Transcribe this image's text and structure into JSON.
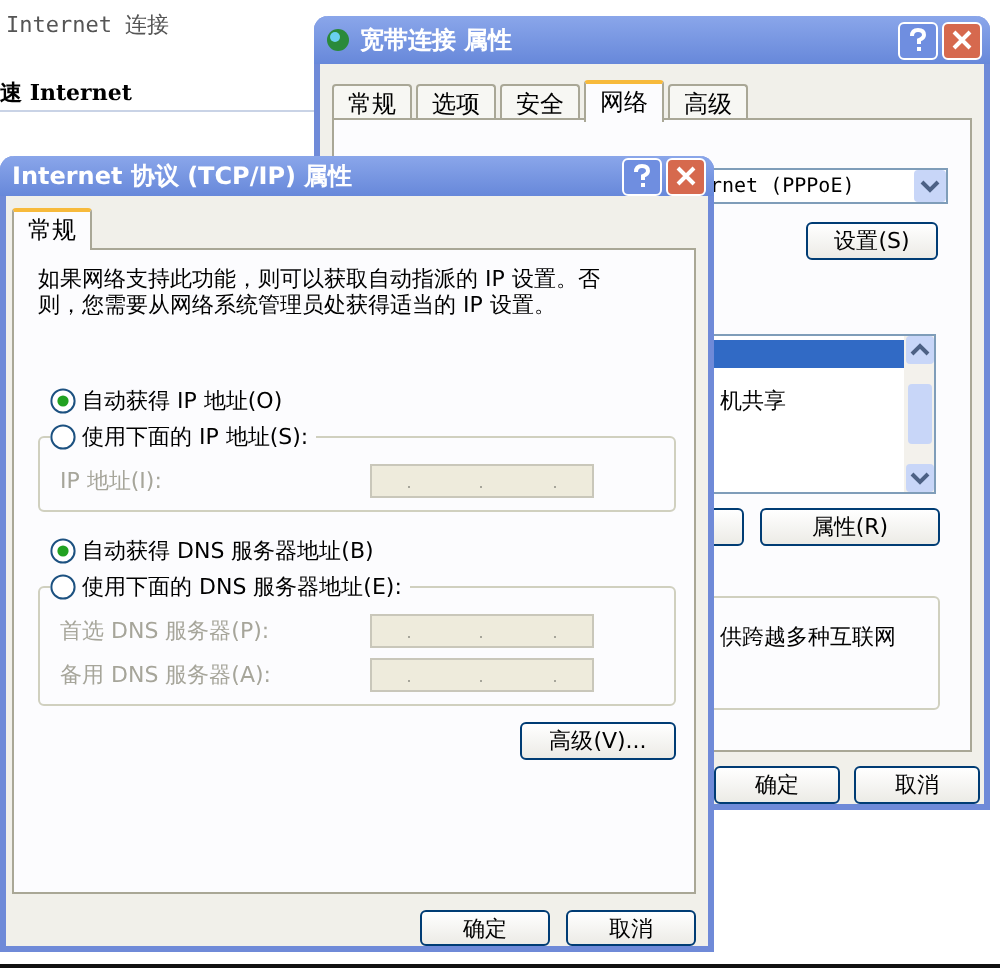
{
  "background_window": {
    "subtitle": "Internet 连接",
    "heading": "速 Internet"
  },
  "back_dialog": {
    "title": "宽带连接 属性",
    "tabs": [
      {
        "label": "常规",
        "selected": false
      },
      {
        "label": "选项",
        "selected": false
      },
      {
        "label": "安全",
        "selected": false
      },
      {
        "label": "网络",
        "selected": true
      },
      {
        "label": "高级",
        "selected": false
      }
    ],
    "connection_type": "rnet (PPPoE)",
    "settings_button": "设置(S)",
    "list_rows": [
      {
        "selected": true
      },
      {
        "text": "机共享",
        "selected": false
      }
    ],
    "properties_button": "属性(R)",
    "group_text": "供跨越多种互联网",
    "buttons": [
      "确定",
      "取消"
    ]
  },
  "front_dialog": {
    "title": "Internet 协议 (TCP/IP) 属性",
    "tabs": [
      {
        "label": "常规",
        "selected": true
      }
    ],
    "description": "如果网络支持此功能，则可以获取自动指派的 IP 设置。否则，您需要从网络系统管理员处获得适当的 IP 设置。",
    "ip_options": [
      {
        "label": "自动获得 IP 地址(O)",
        "selected": true
      },
      {
        "label": "使用下面的 IP 地址(S):",
        "selected": false
      }
    ],
    "ip_fields": [
      {
        "label": "IP 地址(I):",
        "disabled": true
      }
    ],
    "dns_options": [
      {
        "label": "自动获得 DNS 服务器地址(B)",
        "selected": true
      },
      {
        "label": "使用下面的 DNS 服务器地址(E):",
        "selected": false
      }
    ],
    "dns_fields": [
      {
        "label": "首选 DNS 服务器(P):",
        "disabled": true
      },
      {
        "label": "备用 DNS 服务器(A):",
        "disabled": true
      }
    ],
    "advanced_button": "高级(V)...",
    "buttons": [
      "确定",
      "取消"
    ]
  }
}
